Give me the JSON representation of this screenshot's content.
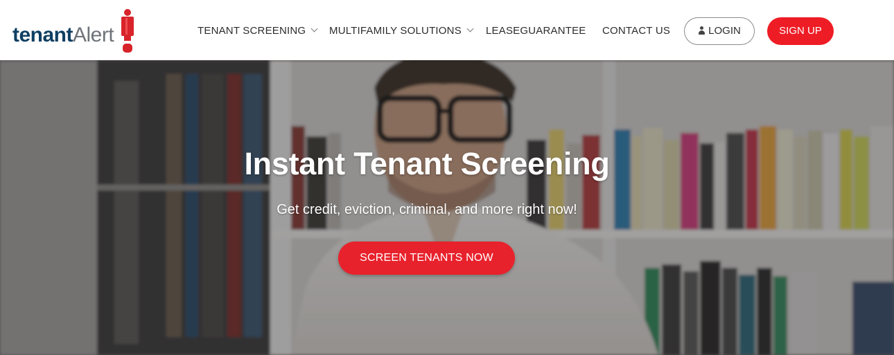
{
  "brand": {
    "logo_bold": "tenant",
    "logo_thin": "Alert",
    "accent_color": "#ee1c25",
    "navy_color": "#0f3f63"
  },
  "nav": {
    "items": [
      {
        "label": "TENANT SCREENING",
        "has_dropdown": true
      },
      {
        "label": "MULTIFAMILY SOLUTIONS",
        "has_dropdown": true
      },
      {
        "label": "LEASEGUARANTEE",
        "has_dropdown": false
      },
      {
        "label": "CONTACT US",
        "has_dropdown": false
      }
    ],
    "login_label": "LOGIN",
    "signup_label": "SIGN UP"
  },
  "hero": {
    "title": "Instant Tenant Screening",
    "subtitle": "Get credit, eviction, criminal, and more right now!",
    "cta_label": "SCREEN TENANTS NOW"
  }
}
